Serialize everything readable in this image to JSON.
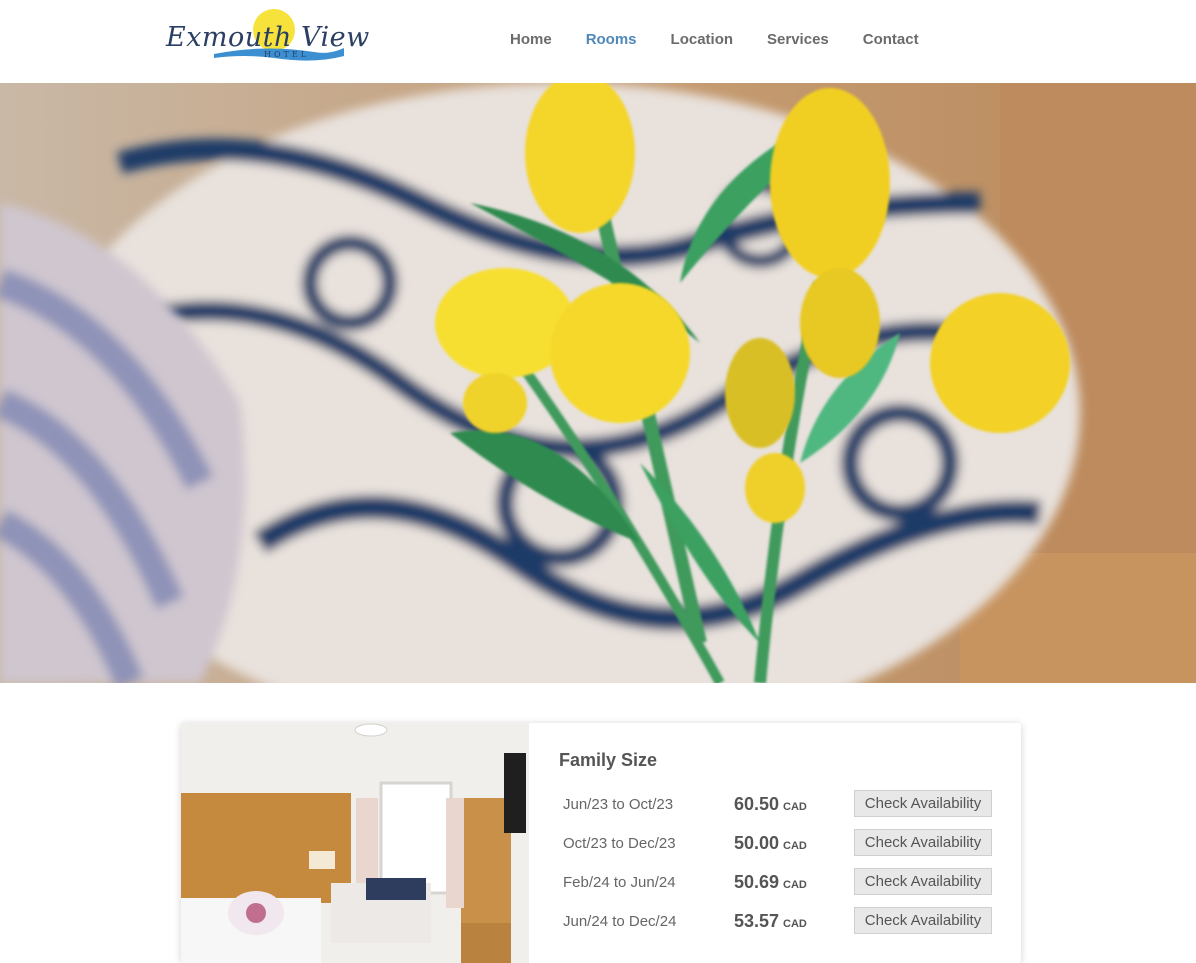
{
  "brand": {
    "name": "Exmouth View",
    "subtitle": "HOTEL"
  },
  "nav": {
    "items": [
      {
        "label": "Home",
        "active": false
      },
      {
        "label": "Rooms",
        "active": true
      },
      {
        "label": "Location",
        "active": false
      },
      {
        "label": "Services",
        "active": false
      },
      {
        "label": "Contact",
        "active": false
      }
    ]
  },
  "room": {
    "title": "Family Size",
    "rates": [
      {
        "dates": "Jun/23 to Oct/23",
        "price": "60.50",
        "currency": "CAD",
        "button": "Check Availability"
      },
      {
        "dates": "Oct/23 to Dec/23",
        "price": "50.00",
        "currency": "CAD",
        "button": "Check Availability"
      },
      {
        "dates": "Feb/24 to Jun/24",
        "price": "50.69",
        "currency": "CAD",
        "button": "Check Availability"
      },
      {
        "dates": "Jun/24 to Dec/24",
        "price": "53.57",
        "currency": "CAD",
        "button": "Check Availability"
      }
    ]
  },
  "colors": {
    "nav_active": "#4f88b8",
    "nav_default": "#6b6b6b",
    "logo_navy": "#2a3f63"
  }
}
